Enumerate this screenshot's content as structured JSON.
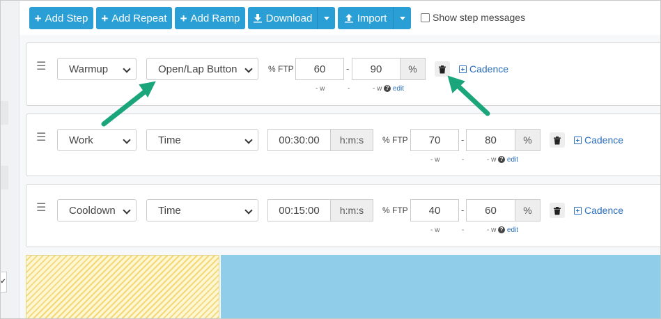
{
  "toolbar": {
    "add_step": "Add Step",
    "add_repeat": "Add Repeat",
    "add_ramp": "Add Ramp",
    "download": "Download",
    "import": "Import",
    "show_messages": "Show step messages",
    "accent_color": "#2a9fd6"
  },
  "steps": [
    {
      "type": "Warmup",
      "duration_type": "Open/Lap Button",
      "ftp_label": "% FTP",
      "low": "60",
      "high": "90",
      "unit": "%",
      "sub_low": "- w",
      "sub_dash": "-",
      "sub_high": "- w",
      "edit": "edit",
      "cadence": "Cadence"
    },
    {
      "type": "Work",
      "duration_type": "Time",
      "duration": "00:30:00",
      "duration_unit": "h:m:s",
      "ftp_label": "% FTP",
      "low": "70",
      "high": "80",
      "unit": "%",
      "sub_low": "- w",
      "sub_dash": "-",
      "sub_high": "- w",
      "edit": "edit",
      "cadence": "Cadence"
    },
    {
      "type": "Cooldown",
      "duration_type": "Time",
      "duration": "00:15:00",
      "duration_unit": "h:m:s",
      "ftp_label": "% FTP",
      "low": "40",
      "high": "60",
      "unit": "%",
      "sub_low": "- w",
      "sub_dash": "-",
      "sub_high": "- w",
      "edit": "edit",
      "cadence": "Cadence"
    }
  ],
  "icons": {
    "plus": "plus-icon",
    "download": "download-icon",
    "upload": "upload-icon",
    "trash": "trash-icon",
    "drag": "drag-handle-icon",
    "help": "question-circle-icon"
  },
  "annotation_color": "#1aa57b"
}
